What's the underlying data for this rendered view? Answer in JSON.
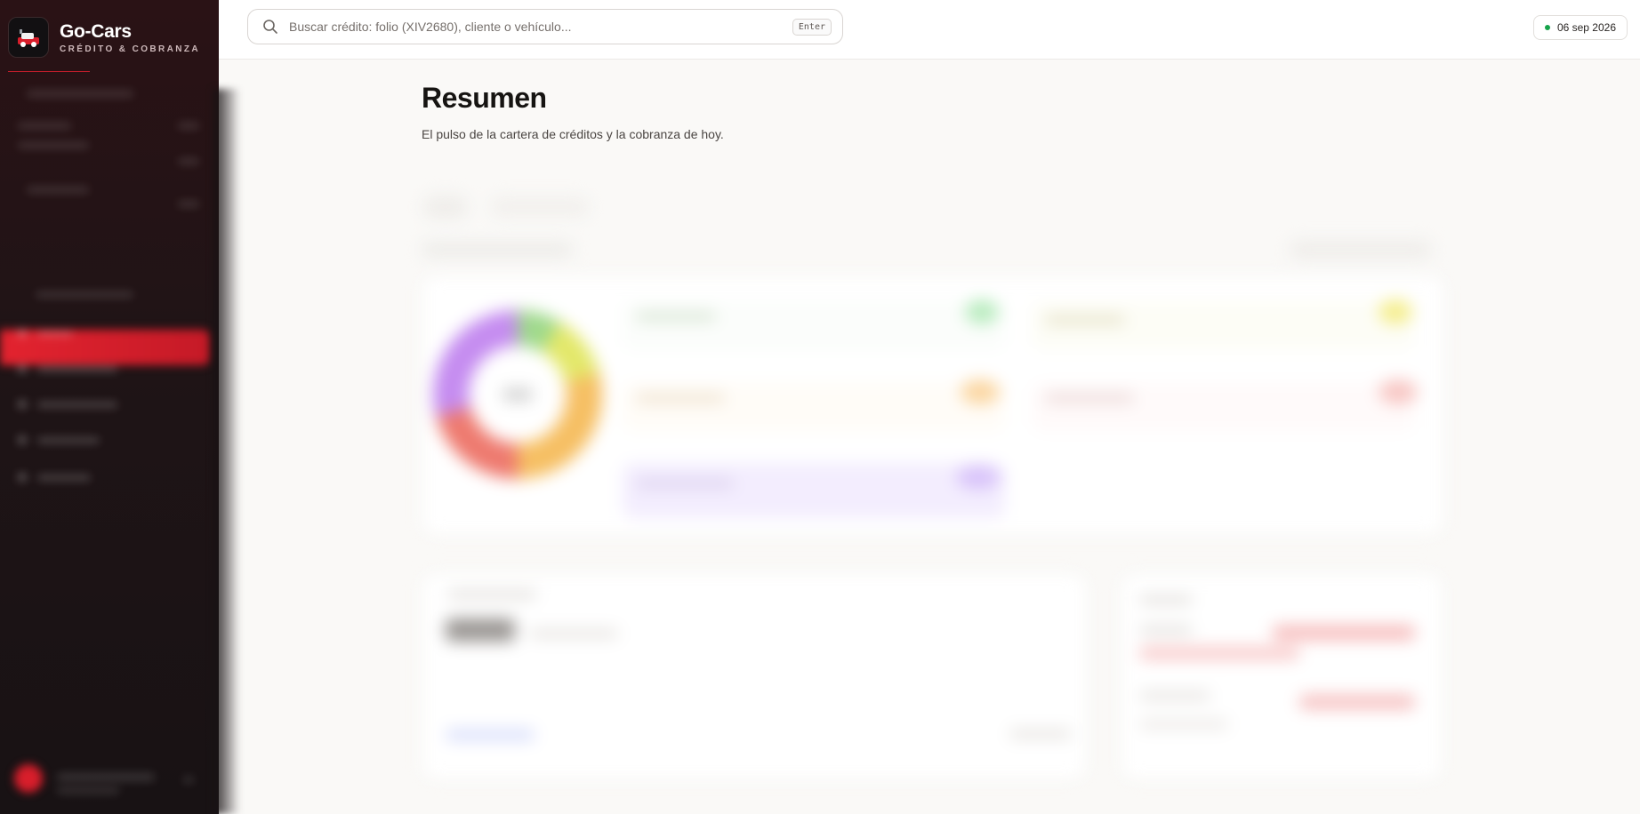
{
  "brand": {
    "name": "Go-Cars",
    "subtitle": "CRÉDITO & COBRANZA",
    "accent_color": "#c21d2b"
  },
  "search": {
    "placeholder": "Buscar crédito: folio (XIV2680), cliente o vehículo...",
    "shortcut": "Enter"
  },
  "header": {
    "date": "06 sep 2026",
    "status_color": "#16a34a"
  },
  "main": {
    "title": "Resumen",
    "subtitle": "El pulso de la cartera de créditos y la cobranza de hoy."
  },
  "icons": {
    "search": "search-icon",
    "logo": "go-cars-logo-icon"
  },
  "colors": {
    "sidebar_bg": "#1f1416",
    "active_nav": "#e3232f",
    "page_bg": "#faf9f7"
  }
}
